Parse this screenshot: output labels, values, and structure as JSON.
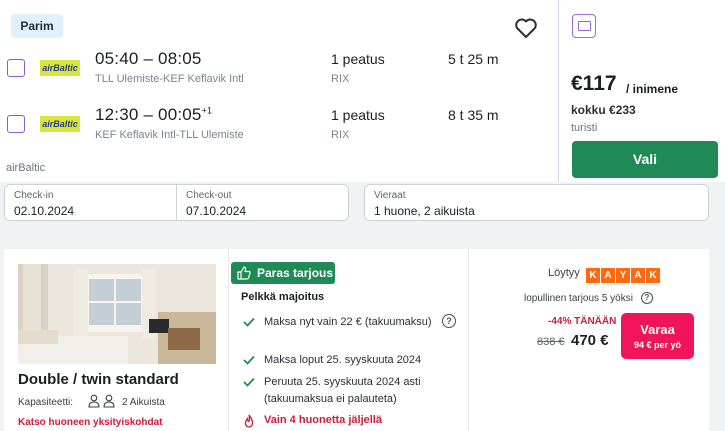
{
  "flight": {
    "badge": "Parim",
    "legs": [
      {
        "times": "05:40 – 08:05",
        "next_day": "",
        "route": "TLL Ulemiste-KEF Keflavik Intl",
        "stops": "1 peatus",
        "via": "RIX",
        "duration": "5 t 25 m"
      },
      {
        "times": "12:30 – 00:05",
        "next_day": "+1",
        "route": "KEF Keflavik Intl-TLL Ulemiste",
        "stops": "1 peatus",
        "via": "RIX",
        "duration": "8 t 35 m"
      }
    ],
    "airline_logo_text": "airBaltic",
    "airline": "airBaltic",
    "price": "€117",
    "price_per": "/ inimene",
    "total": "kokku €233",
    "fare_class": "turisti",
    "select_label": "Vali",
    "icons": {
      "save": "heart-icon",
      "fare": "fare-details-icon"
    },
    "colors": {
      "accent": "#8e59c9",
      "select": "#1f8a56"
    }
  },
  "search": {
    "checkin_label": "Check-in",
    "checkin_value": "02.10.2024",
    "checkout_label": "Check-out",
    "checkout_value": "07.10.2024",
    "guests_label": "Vieraat",
    "guests_value": "1 huone, 2 aikuista"
  },
  "hotel": {
    "room_title": "Double / twin standard",
    "capacity_label": "Kapasiteetti:",
    "capacity_value": "2 Aikuista",
    "room_details_link": "Katso huoneen yksityiskohdat",
    "best_offer": "Paras tarjous",
    "room_only": "Pelkkä majoitus",
    "conditions": [
      "Maksa nyt vain 22 € (takuumaksu)",
      "Maksa loput 25. syyskuuta 2024",
      "Peruuta 25. syyskuuta 2024 asti (takuumaksua ei palauteta)"
    ],
    "rooms_left": "Vain 4 huonetta jäljellä",
    "found_label": "Löytyy",
    "provider_letters": [
      "K",
      "A",
      "Y",
      "A",
      "K"
    ],
    "final_offer": "lopullinen tarjous 5 yöksi",
    "discount": "-44% TÄNÄÄN",
    "old_price": "838 €",
    "new_price": "470 €",
    "book_label": "Varaa",
    "book_sub": "94 € per yö",
    "colors": {
      "best": "#1f8a56",
      "urgent": "#d11b3a",
      "book": "#f0145a",
      "kayak": "#ff690f"
    }
  }
}
